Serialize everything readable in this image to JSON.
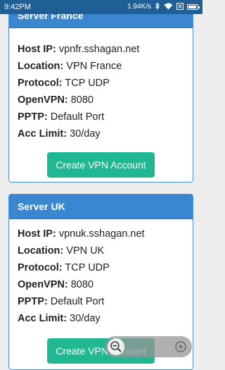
{
  "status_bar": {
    "time": "9:42PM",
    "speed": "1.94K/s",
    "icons": [
      "bluetooth-icon",
      "wifi-icon",
      "sim-icon",
      "battery-icon"
    ]
  },
  "servers": [
    {
      "title": "Server France",
      "rows": [
        {
          "key": "Host IP:",
          "value": "vpnfr.sshagan.net"
        },
        {
          "key": "Location:",
          "value": "VPN France"
        },
        {
          "key": "Protocol:",
          "value": "TCP UDP"
        },
        {
          "key": "OpenVPN:",
          "value": "8080"
        },
        {
          "key": "PPTP:",
          "value": "Default Port"
        },
        {
          "key": "Acc Limit:",
          "value": "30/day"
        }
      ],
      "button": "Create VPN Account"
    },
    {
      "title": "Server UK",
      "rows": [
        {
          "key": "Host IP:",
          "value": "vpnuk.sshagan.net"
        },
        {
          "key": "Location:",
          "value": "VPN UK"
        },
        {
          "key": "Protocol:",
          "value": "TCP UDP"
        },
        {
          "key": "OpenVPN:",
          "value": "8080"
        },
        {
          "key": "PPTP:",
          "value": "Default Port"
        },
        {
          "key": "Acc Limit:",
          "value": "30/day"
        }
      ],
      "button": "Create VPN Account"
    }
  ],
  "zoom_controls": {
    "zoom_out_icon": "zoom-out-icon",
    "zoom_in_icon": "zoom-in-icon"
  },
  "colors": {
    "header": "#3a87cf",
    "button": "#1fb893",
    "status_bar": "#1f5f96"
  }
}
